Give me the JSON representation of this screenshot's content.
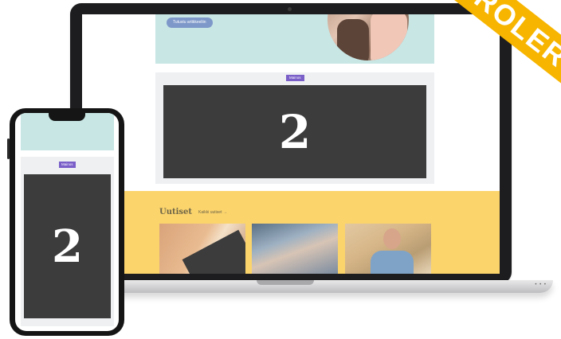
{
  "laptop": {
    "hero": {
      "button_label": "Tutustu artikkeeliin"
    },
    "ad": {
      "label": "Mainos",
      "number": "2"
    },
    "news": {
      "title": "Uutiset",
      "all_link": "Kaikki uutiset →"
    }
  },
  "phone": {
    "ad": {
      "label": "Mainos",
      "number": "2"
    }
  },
  "ribbon": {
    "text": "ROLER"
  },
  "colors": {
    "hero_bg": "#c7e6e4",
    "ad_label": "#7a5fc9",
    "ad_dark": "#3c3c3c",
    "news_bg": "#fbd46c",
    "ribbon": "#f7b500"
  }
}
